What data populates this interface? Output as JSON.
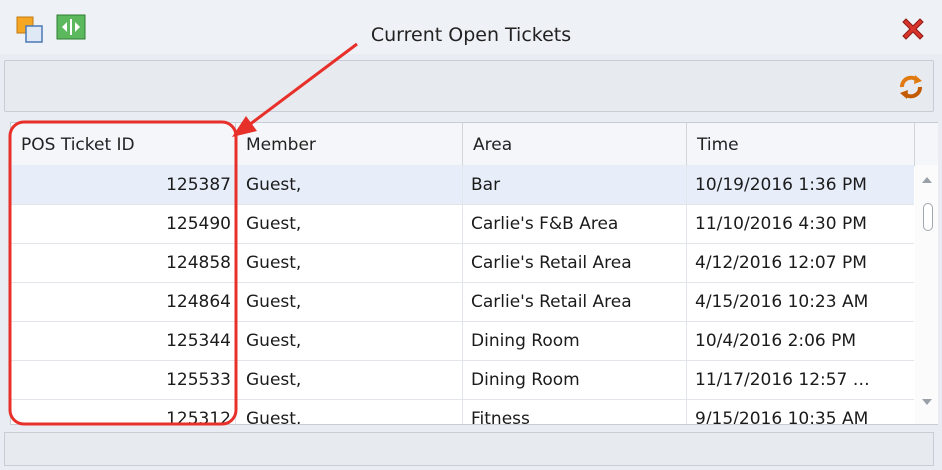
{
  "window": {
    "title": "Current Open Tickets"
  },
  "icons": {
    "app": "cascade-windows-icon",
    "expand": "expand-width-icon",
    "close": "close-icon",
    "refresh": "refresh-icon"
  },
  "colors": {
    "highlight": "#e8302a",
    "selected_row": "#e7eefa"
  },
  "table": {
    "columns": [
      "POS Ticket ID",
      "Member",
      "Area",
      "Time"
    ],
    "rows": [
      {
        "id": "125387",
        "member": "Guest,",
        "area": "Bar",
        "time": "10/19/2016 1:36 PM"
      },
      {
        "id": "125490",
        "member": "Guest,",
        "area": "Carlie's F&B Area",
        "time": "11/10/2016 4:30 PM"
      },
      {
        "id": "124858",
        "member": "Guest,",
        "area": "Carlie's Retail Area",
        "time": "4/12/2016 12:07 PM"
      },
      {
        "id": "124864",
        "member": "Guest,",
        "area": "Carlie's Retail Area",
        "time": "4/15/2016 10:23 AM"
      },
      {
        "id": "125344",
        "member": "Guest,",
        "area": "Dining Room",
        "time": "10/4/2016 2:06 PM"
      },
      {
        "id": "125533",
        "member": "Guest,",
        "area": "Dining Room",
        "time": "11/17/2016 12:57 …"
      },
      {
        "id": "125312",
        "member": "Guest,",
        "area": "Fitness",
        "time": "9/15/2016 10:35 AM"
      }
    ]
  }
}
